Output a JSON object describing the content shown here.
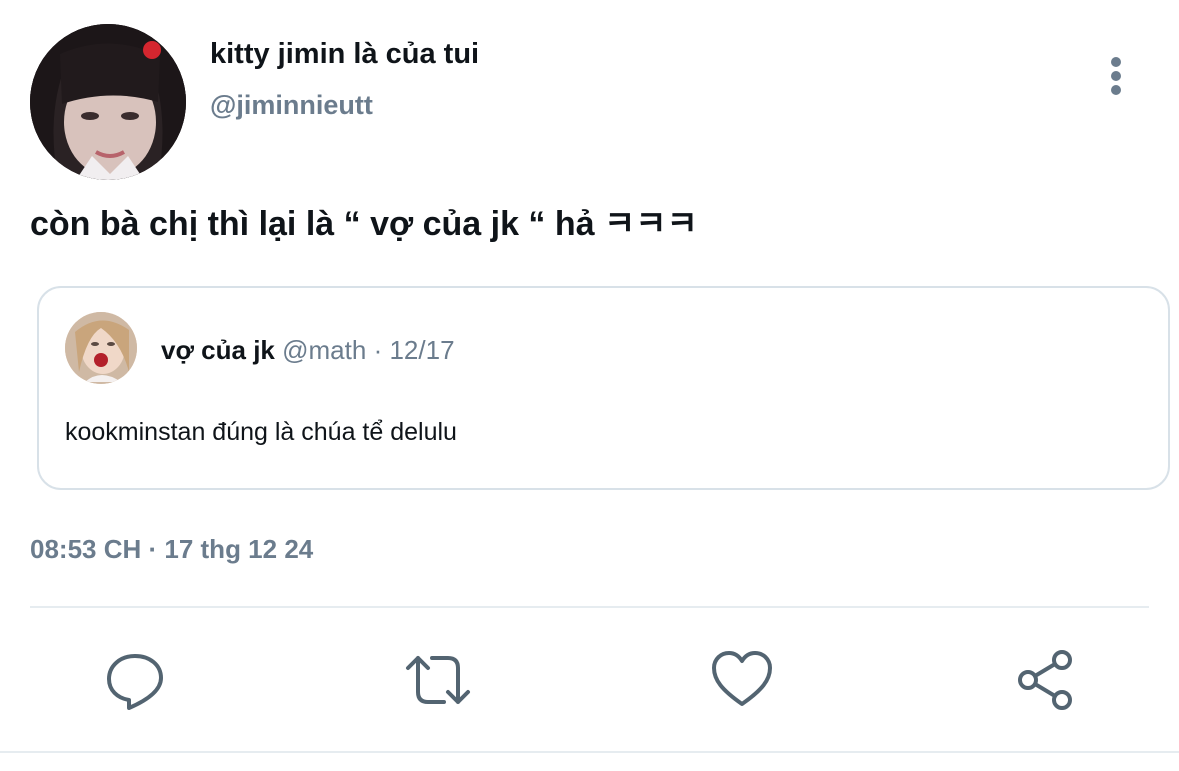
{
  "author": {
    "display_name": "kitty jimin là của tui",
    "handle": "@jiminnieutt",
    "avatar_icon": "profile-photo"
  },
  "menu": {
    "icon": "more-vertical-icon"
  },
  "tweet": {
    "text": "còn bà chị thì lại là “ vợ của jk “ hả ㅋㅋㅋ",
    "timestamp": "08:53 CH · 17 thg 12 24"
  },
  "quote": {
    "display_name": "vợ của jk",
    "handle": "@math",
    "separator": "·",
    "date": "12/17",
    "text": "kookminstan đúng là chúa tể delulu",
    "avatar_icon": "profile-photo"
  },
  "actions": {
    "reply_icon": "reply-icon",
    "retweet_icon": "retweet-icon",
    "like_icon": "heart-icon",
    "share_icon": "share-icon"
  },
  "colors": {
    "text_primary": "#0f1419",
    "text_secondary": "#6b7c8d",
    "border": "#d8e1e8",
    "icon": "#536471"
  }
}
